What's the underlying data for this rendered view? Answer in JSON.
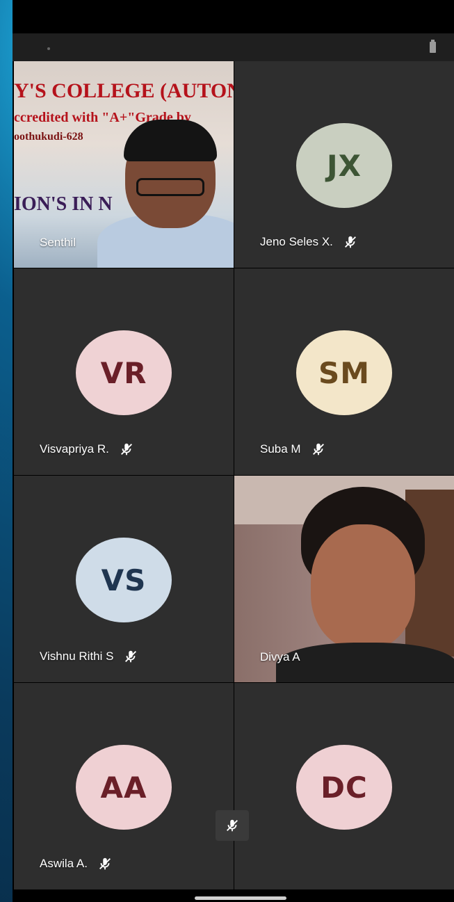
{
  "meeting": {
    "participants": [
      {
        "name": "Senthil",
        "initials": "",
        "video": true
      },
      {
        "name": "Jeno Seles X.",
        "initials": "JX",
        "muted": true,
        "avatar_bg": "#c9cfc0",
        "avatar_fg": "#3d5535"
      },
      {
        "name": "Visvapriya R.",
        "initials": "VR",
        "muted": true,
        "avatar_bg": "#efd2d4",
        "avatar_fg": "#6a1f28"
      },
      {
        "name": "Suba M",
        "initials": "SM",
        "muted": true,
        "avatar_bg": "#f3e6c9",
        "avatar_fg": "#6a4a1e"
      },
      {
        "name": "Vishnu Rithi S",
        "initials": "VS",
        "muted": true,
        "avatar_bg": "#cfdce8",
        "avatar_fg": "#1f3550"
      },
      {
        "name": "Divya A",
        "initials": "",
        "video": true
      },
      {
        "name": "Aswila A.",
        "initials": "AA",
        "muted": true,
        "avatar_bg": "#efd0d3",
        "avatar_fg": "#6a1f28"
      },
      {
        "name": "",
        "initials": "DC",
        "muted": false,
        "avatar_bg": "#efd0d3",
        "avatar_fg": "#6a1f28"
      }
    ]
  },
  "banner": {
    "line1": "Y'S COLLEGE (AUTON",
    "line2": "ccredited with \"A+\"Grade by",
    "line3": "oothukudi-628",
    "line4": "ION'S  IN      N"
  },
  "icons": {
    "mic_muted": "mic-off-icon",
    "battery": "battery-icon"
  }
}
